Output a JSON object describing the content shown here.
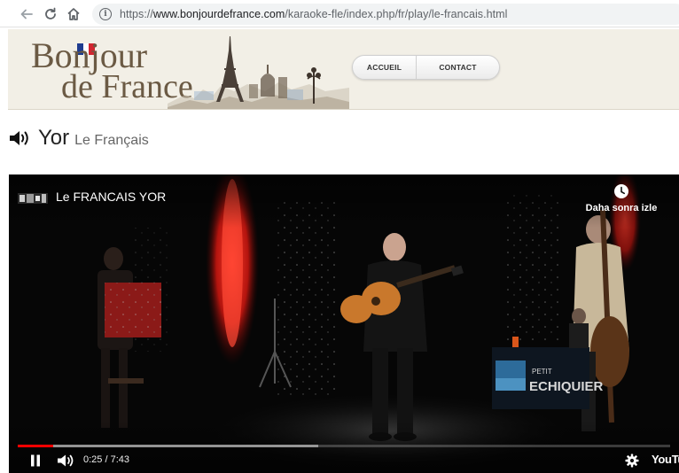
{
  "browser": {
    "url_prefix": "https://",
    "url_host": "www.bonjourdefrance.com",
    "url_path": "/karaoke-fle/index.php/fr/play/le-francais.html",
    "icons": [
      "back-icon",
      "reload-icon",
      "home-icon",
      "info-icon"
    ]
  },
  "site": {
    "logo_line1": "Bonjour",
    "logo_line2": "de France",
    "menu": {
      "home_label": "ACCUEIL",
      "contact_label": "CONTACT"
    },
    "colors": {
      "header_bg": "#f2efe6",
      "logo_text": "#6b5a44",
      "flag": [
        "#1f3c8f",
        "#ffffff",
        "#d22630"
      ]
    }
  },
  "page": {
    "title": "Yor",
    "subtitle": "Le Français"
  },
  "video": {
    "title": "Le FRANCAIS YOR",
    "watch_later_label": "Daha sonra izle",
    "current_time": "0:25",
    "duration": "7:43",
    "time_separator": " / ",
    "played_fraction": 0.054,
    "buffered_fraction": 0.46,
    "stage_sign": "ECHIQUIER",
    "stage_sign_small": "PETIT",
    "brand": "YouTu",
    "colors": {
      "progress": "#ff0000",
      "curtain_light": "#e0221a"
    }
  }
}
